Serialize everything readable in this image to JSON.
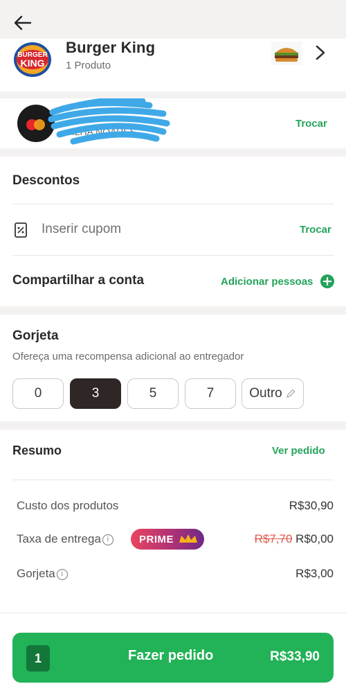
{
  "header": {
    "back_icon": "arrow-left-icon"
  },
  "store": {
    "name": "Burger King",
    "logo_text_top": "BURGER",
    "logo_text_bottom": "KING",
    "products_count": "1 Produto",
    "thumb_icon": "burger-image-icon",
    "chevron_icon": "chevron-right-icon"
  },
  "payment": {
    "card_icon": "mastercard-icon",
    "card_text": "...LHA NOARES",
    "change_label": "Trocar"
  },
  "discounts": {
    "title": "Descontos",
    "coupon_icon": "coupon-icon",
    "coupon_placeholder": "Inserir cupom",
    "change_label": "Trocar"
  },
  "share": {
    "title": "Compartilhar a conta",
    "add_label": "Adicionar pessoas"
  },
  "tip": {
    "title": "Gorjeta",
    "subtitle": "Ofereça uma recompensa adicional ao entregador",
    "options": [
      "0",
      "3",
      "5",
      "7"
    ],
    "selected": "3",
    "other_label": "Outro"
  },
  "summary": {
    "title": "Resumo",
    "view_order_label": "Ver pedido",
    "products_label": "Custo dos produtos",
    "products_value": "R$30,90",
    "delivery_label": "Taxa de entrega",
    "prime_badge": "PRIME",
    "delivery_old": "R$7,70",
    "delivery_new": "R$0,00",
    "tip_label": "Gorjeta",
    "tip_value": "R$3,00"
  },
  "order_button": {
    "quantity": "1",
    "label": "Fazer pedido",
    "total": "R$33,90"
  },
  "colors": {
    "accent_green": "#24a35a",
    "button_green": "#22b257",
    "strike_red": "#e05a4c"
  }
}
